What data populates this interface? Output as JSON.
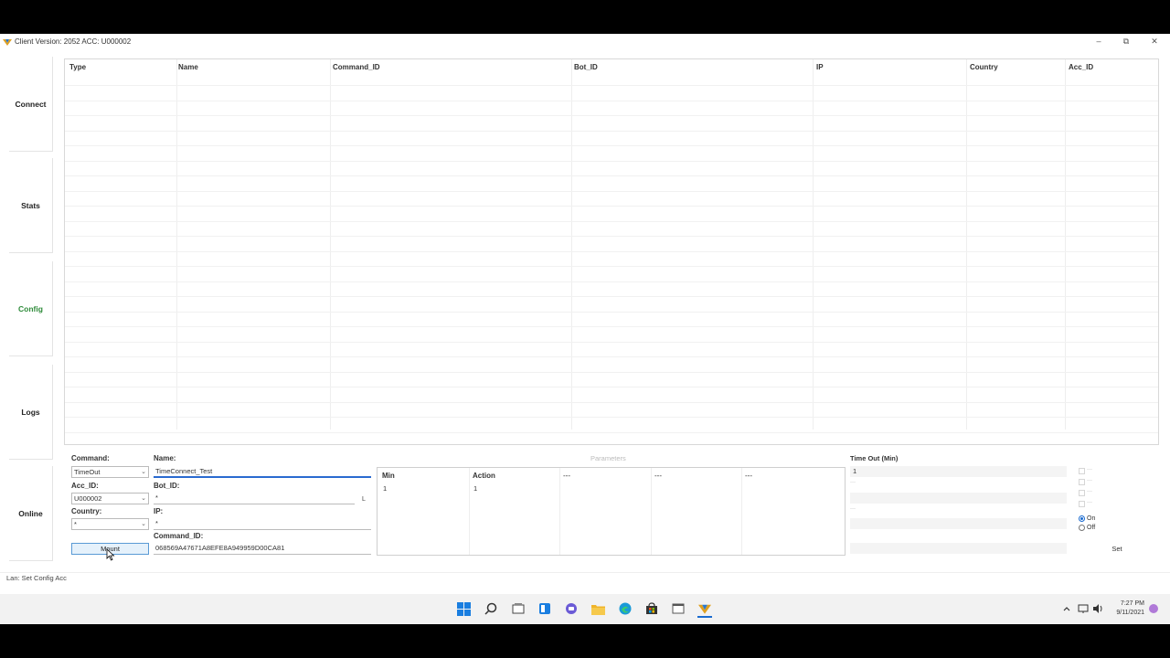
{
  "window": {
    "title": "Client Version: 2052 ACC: U000002",
    "minimize": "–",
    "maximize": "⧉",
    "close": "✕"
  },
  "nav": {
    "connect": "Connect",
    "stats": "Stats",
    "config": "Config",
    "logs": "Logs",
    "online": "Online",
    "active_color": "#2e8b3a"
  },
  "grid": {
    "columns": [
      "Type",
      "Name",
      "Command_ID",
      "Bot_ID",
      "IP",
      "Country",
      "Acc_ID"
    ]
  },
  "form": {
    "command_label": "Command:",
    "command_value": "TimeOut",
    "name_label": "Name:",
    "name_value": "TimeConnect_Test",
    "acc_id_label": "Acc_ID:",
    "acc_id_value": "U000002",
    "bot_id_label": "Bot_ID:",
    "bot_id_value": "*",
    "bot_id_button": "L",
    "country_label": "Country:",
    "country_value": "*",
    "ip_label": "IP:",
    "ip_value": "*",
    "command_id_label": "Command_ID:",
    "command_id_value": "068569A47671A8EFE8A949959D00CA81",
    "mount_button": "Mount"
  },
  "parameters": {
    "title": "Parameters",
    "headers": [
      "Min",
      "Action",
      "---",
      "---",
      "---"
    ],
    "values": [
      "1",
      "1"
    ]
  },
  "timeout": {
    "label": "Time Out (Min)",
    "value": "1",
    "placeholders": [
      "---",
      "---"
    ],
    "checkbox_labels": [
      "---",
      "---",
      "---",
      "---"
    ],
    "radio_on": "On",
    "radio_off": "Off",
    "set_button": "Set"
  },
  "status": {
    "text": "Lan: Set Config Acc"
  },
  "taskbar": {
    "time": "7:27 PM",
    "date": "9/11/2021"
  }
}
